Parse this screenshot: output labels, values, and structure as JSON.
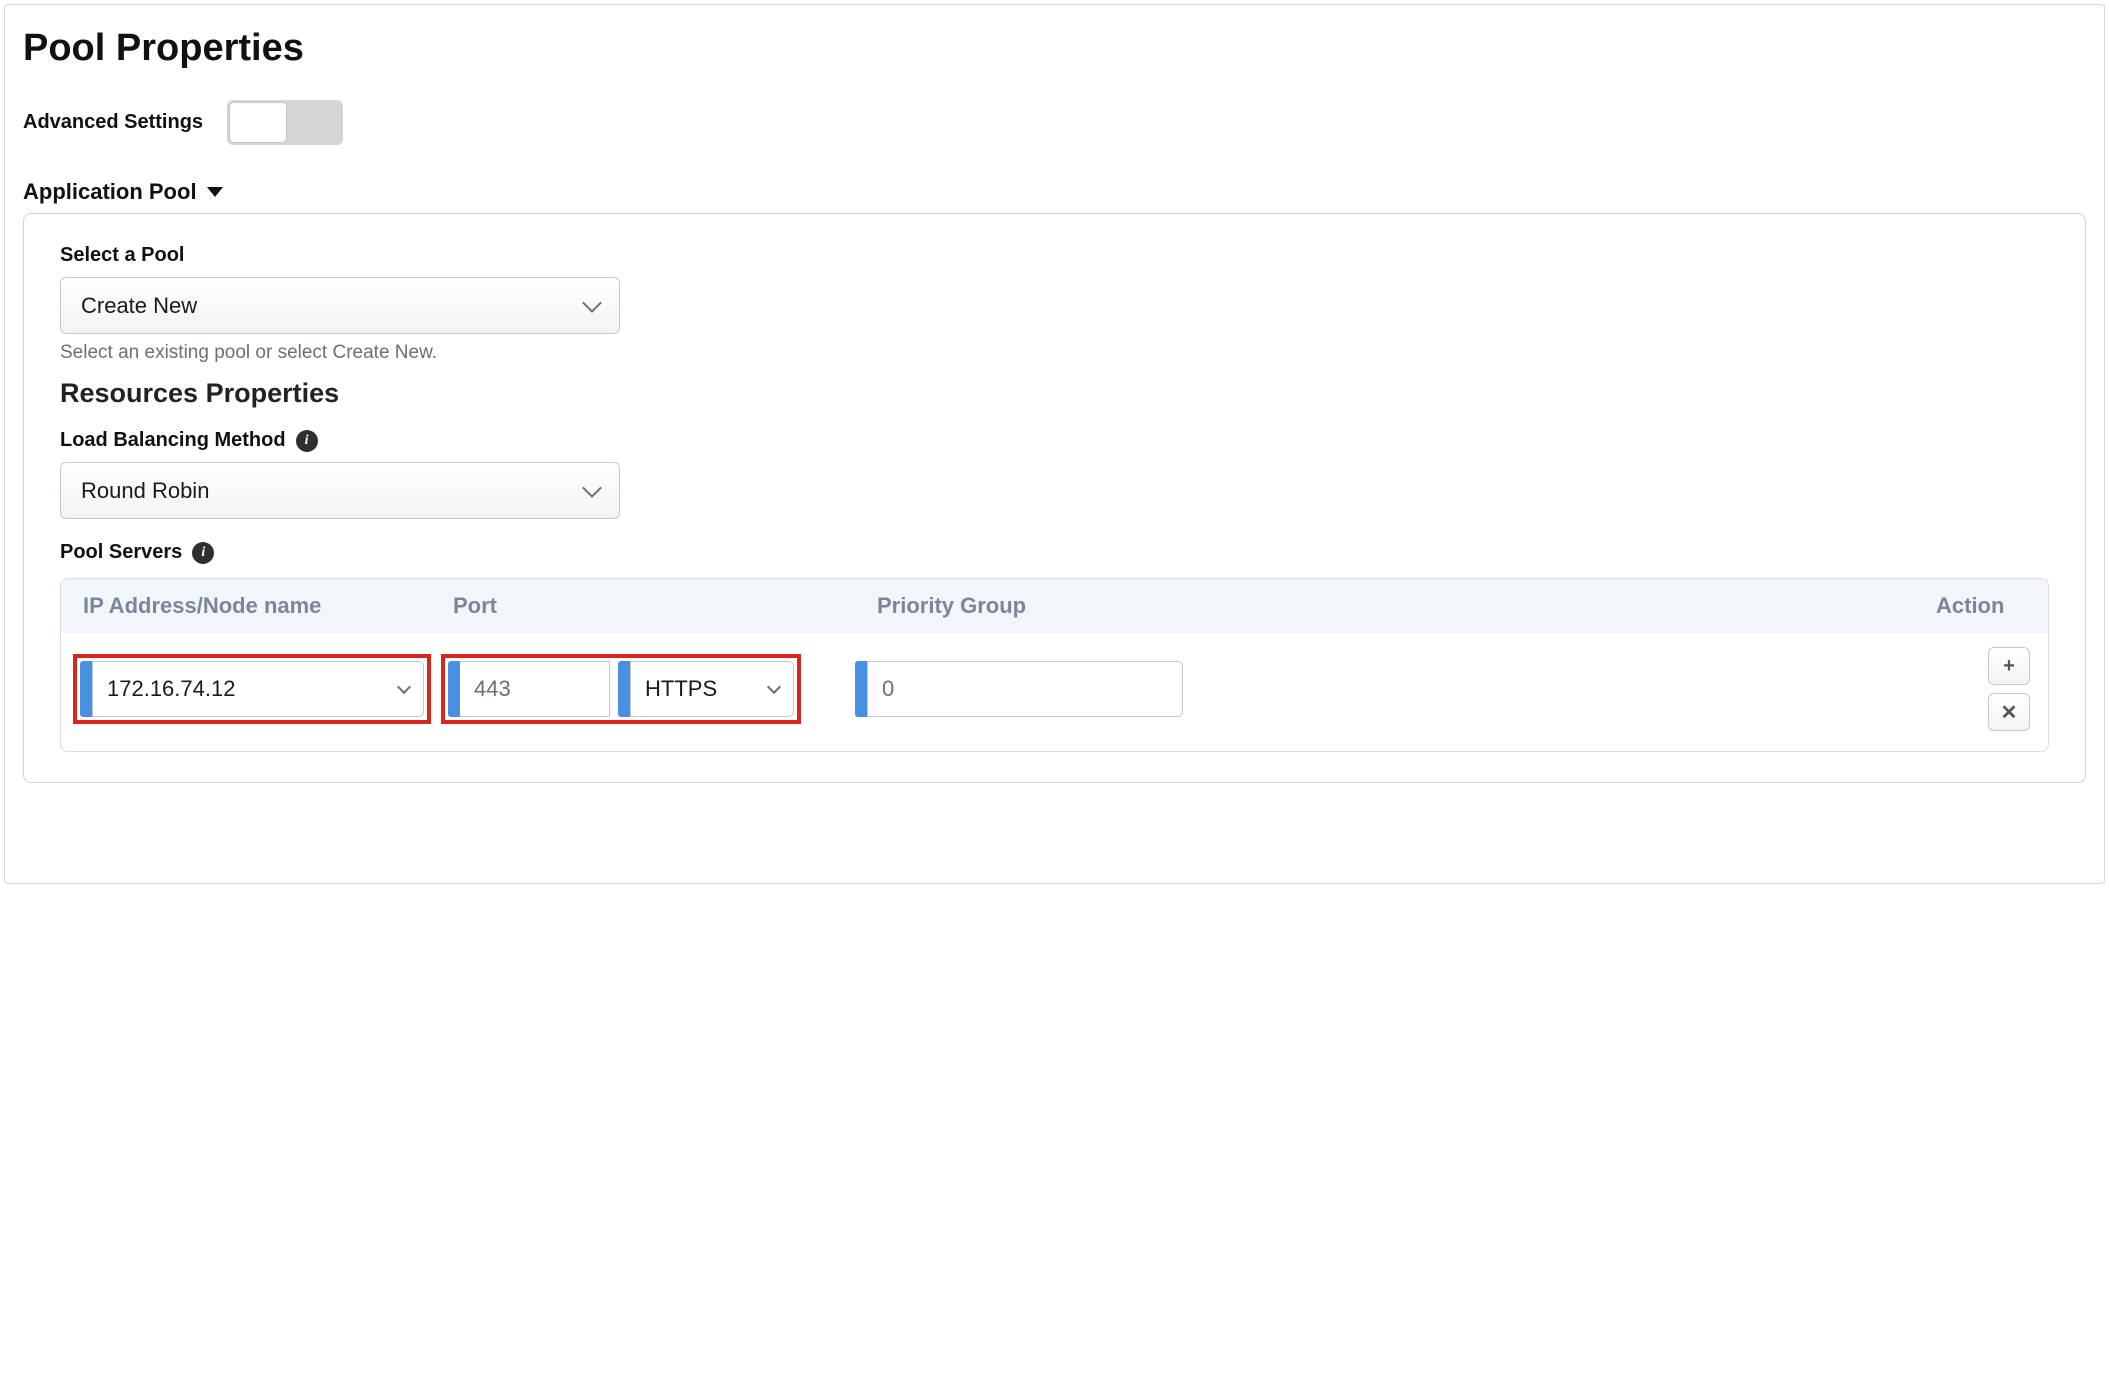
{
  "page_title": "Pool Properties",
  "advanced_settings_label": "Advanced Settings",
  "advanced_settings_on": false,
  "section": {
    "title": "Application Pool",
    "select_pool_label": "Select a Pool",
    "select_pool_value": "Create New",
    "select_pool_hint": "Select an existing pool or select Create New.",
    "resources_heading": "Resources Properties",
    "lb_method_label": "Load Balancing Method",
    "lb_method_value": "Round Robin",
    "pool_servers_label": "Pool Servers",
    "table": {
      "headers": {
        "ip": "IP Address/Node name",
        "port": "Port",
        "priority": "Priority Group",
        "action": "Action"
      },
      "row": {
        "ip": "172.16.74.12",
        "port": "443",
        "protocol": "HTTPS",
        "priority": "0"
      }
    }
  },
  "icons": {
    "info": "i",
    "plus": "+",
    "times": "✕"
  }
}
